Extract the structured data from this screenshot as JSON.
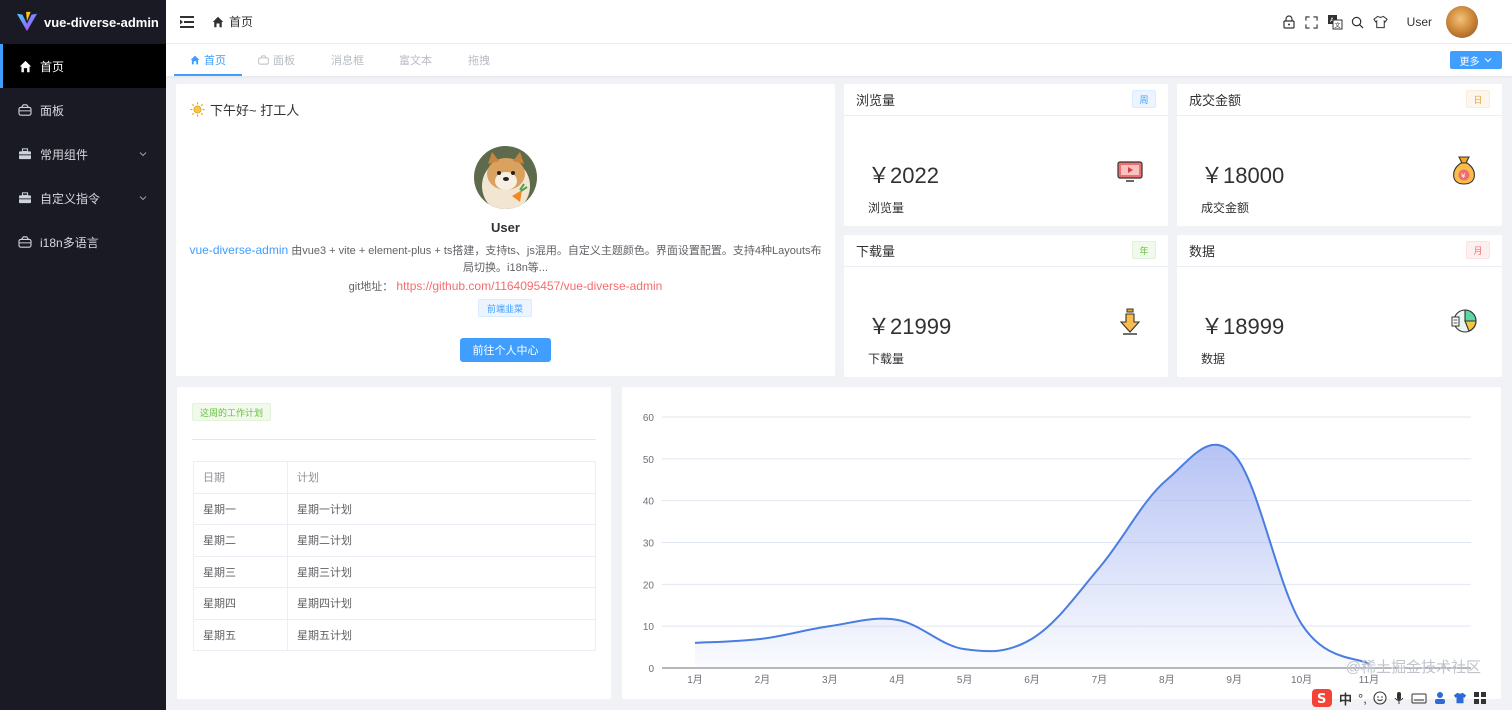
{
  "app": {
    "title": "vue-diverse-admin"
  },
  "sidebar": {
    "items": [
      {
        "label": "首页",
        "icon": "home-icon",
        "active": true
      },
      {
        "label": "面板",
        "icon": "panel-icon",
        "active": false
      },
      {
        "label": "常用组件",
        "icon": "briefcase-icon",
        "active": false,
        "has_children": true
      },
      {
        "label": "自定义指令",
        "icon": "briefcase-icon",
        "active": false,
        "has_children": true
      },
      {
        "label": "i18n多语言",
        "icon": "panel-icon",
        "active": false
      }
    ]
  },
  "header": {
    "breadcrumb": "首页",
    "username": "User",
    "icons": [
      "lock-icon",
      "fullscreen-icon",
      "translate-icon",
      "search-icon",
      "shirt-icon"
    ]
  },
  "tabs": {
    "items": [
      {
        "label": "首页",
        "active": true
      },
      {
        "label": "面板",
        "active": false
      },
      {
        "label": "消息框",
        "active": false
      },
      {
        "label": "富文本",
        "active": false
      },
      {
        "label": "拖拽",
        "active": false
      }
    ],
    "more_label": "更多"
  },
  "welcome": {
    "greeting": "下午好~ 打工人",
    "username": "User",
    "project_link": "vue-diverse-admin",
    "description": " 由vue3 + vite + element-plus + ts搭建，支持ts、js混用。自定义主题颜色。界面设置配置。支持4种Layouts布局切换。i18n等...",
    "git_label": "git地址：",
    "git_url": "https://github.com/1164095457/vue-diverse-admin",
    "tag": "前端韭菜",
    "button": "前往个人中心"
  },
  "stats": [
    {
      "title": "浏览量",
      "badge": "周",
      "amount": "￥2022",
      "sub": "浏览量",
      "badge_color": "#409eff",
      "icon": "tv-icon"
    },
    {
      "title": "成交金额",
      "badge": "日",
      "amount": "￥18000",
      "sub": "成交金额",
      "badge_color": "#e6a23c",
      "icon": "money-bag-icon"
    },
    {
      "title": "下载量",
      "badge": "年",
      "amount": "￥21999",
      "sub": "下载量",
      "badge_color": "#67c23a",
      "icon": "download-icon"
    },
    {
      "title": "数据",
      "badge": "月",
      "amount": "￥18999",
      "sub": "数据",
      "badge_color": "#f56c6c",
      "icon": "pie-chart-icon"
    }
  ],
  "plan": {
    "tag": "这周的工作计划",
    "headers": [
      "日期",
      "计划"
    ],
    "rows": [
      [
        "星期一",
        "星期一计划"
      ],
      [
        "星期二",
        "星期二计划"
      ],
      [
        "星期三",
        "星期三计划"
      ],
      [
        "星期四",
        "星期四计划"
      ],
      [
        "星期五",
        "星期五计划"
      ]
    ]
  },
  "chart_data": {
    "type": "area",
    "categories": [
      "1月",
      "2月",
      "3月",
      "4月",
      "5月",
      "6月",
      "7月",
      "8月",
      "9月",
      "10月",
      "11月"
    ],
    "values": [
      6,
      7,
      10,
      11.5,
      4.5,
      7,
      24,
      45,
      51,
      10.5,
      1
    ],
    "ylim": [
      0,
      60
    ],
    "yticks": [
      0,
      10,
      20,
      30,
      40,
      50,
      60
    ],
    "grid": true,
    "line_color": "#4a7de0",
    "fill_color": "#a9b8f2"
  },
  "watermark": "@稀土掘金技术社区",
  "ime": {
    "label": "中"
  }
}
